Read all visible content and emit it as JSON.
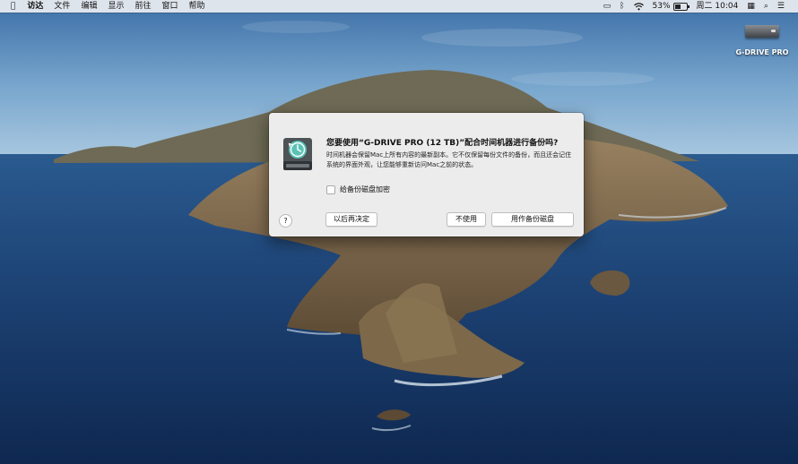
{
  "menubar": {
    "apple_icon": "",
    "app_name": "访达",
    "menus": [
      "文件",
      "编辑",
      "显示",
      "前往",
      "窗口",
      "帮助"
    ],
    "status": {
      "airplay_icon": "▭",
      "bluetooth_icon": "ᛒ",
      "wifi_icon": "wifi-icon",
      "battery_percent": "53%",
      "battery_level": 0.53,
      "clock": "周二 10:04",
      "input_icon": "▦",
      "search_icon": "⌕",
      "control_center_icon": "☰"
    }
  },
  "desktop": {
    "icons": [
      {
        "label": "G-DRIVE PRO"
      }
    ]
  },
  "dialog": {
    "title": "您要使用“G-DRIVE PRO (12 TB)”配合时间机器进行备份吗?",
    "message": "时间机器会保留Mac上所有内容的最新副本。它不仅保留每份文件的备份，而且还会记住系统的界面外观，让您能够重新访问Mac之前的状态。",
    "encrypt_label": "给备份磁盘加密",
    "encrypt_checked": false,
    "help_label": "?",
    "buttons": {
      "later": "以后再决定",
      "dont_use": "不使用",
      "use_as_backup": "用作备份磁盘"
    }
  }
}
